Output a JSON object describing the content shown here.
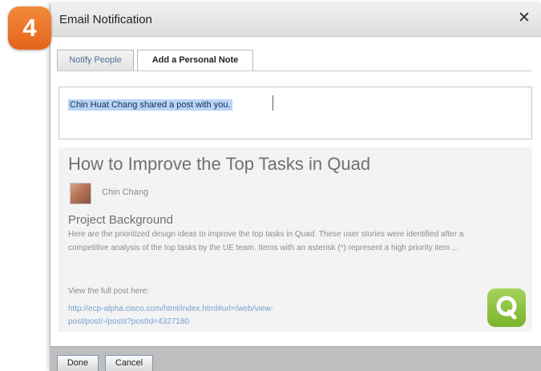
{
  "step_badge": "4",
  "dialog": {
    "title": "Email Notification",
    "close_symbol": "✕"
  },
  "tabs": [
    {
      "label": "Notify People",
      "active": false
    },
    {
      "label": "Add a Personal Note",
      "active": true
    }
  ],
  "personal_note": {
    "value": "Chin Huat Chang shared a post with you."
  },
  "post_preview": {
    "title": "How to Improve the Top Tasks in Quad",
    "author": "Chin Chang",
    "section_title": "Project Background",
    "excerpt": "Here are the prioritized design ideas to improve the top tasks in Quad. These user stories were identified after a competitive analysis of the top tasks by the UE team. Items with an asterisk (*) represent a high priority item ...",
    "view_label": "View the full post here:",
    "link_text": "http://ecp-alpha.cisco.com/html/index.html#url=/web/view-post/post/-/posts?postId=4327180"
  },
  "footer": {
    "done_label": "Done",
    "cancel_label": "Cancel"
  },
  "colors": {
    "badge": "#e86f24",
    "selected_text_bg": "#b8d3f4",
    "link": "#74a1cf",
    "quad_logo": "#8dc63f"
  },
  "icons": [
    "close-icon",
    "quad-logo-icon",
    "avatar"
  ]
}
